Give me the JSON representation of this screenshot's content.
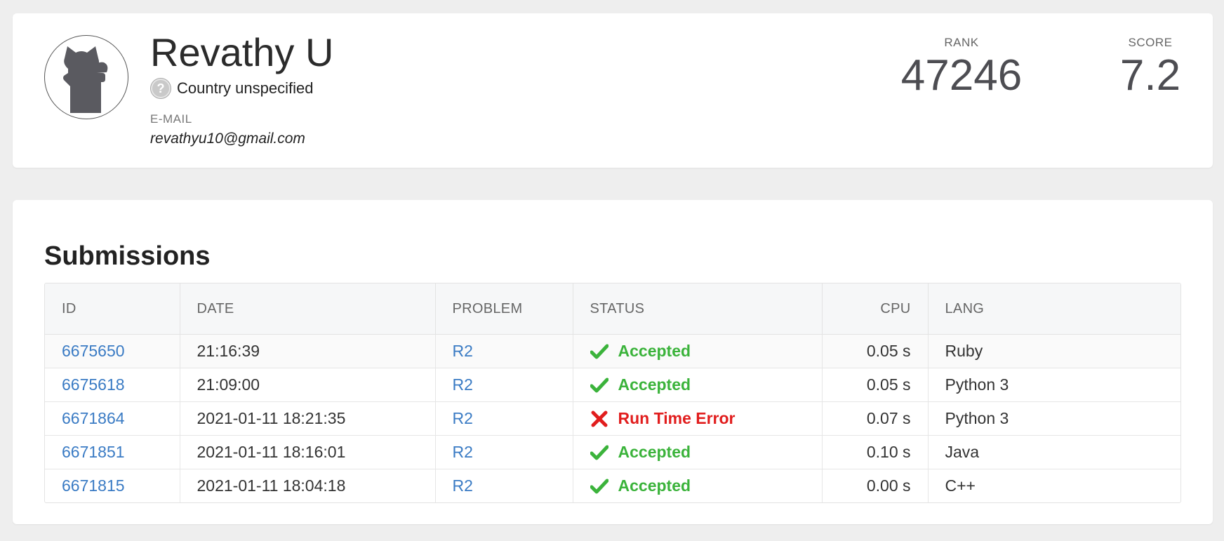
{
  "profile": {
    "name": "Revathy U",
    "country": "Country unspecified",
    "email_label": "E-MAIL",
    "email": "revathyu10@gmail.com",
    "rank_label": "RANK",
    "rank_value": "47246",
    "score_label": "SCORE",
    "score_value": "7.2"
  },
  "submissions": {
    "title": "Submissions",
    "columns": [
      "ID",
      "DATE",
      "PROBLEM",
      "STATUS",
      "CPU",
      "LANG"
    ],
    "rows": [
      {
        "id": "6675650",
        "date": "21:16:39",
        "problem": "R2",
        "status": "Accepted",
        "status_type": "accepted",
        "cpu": "0.05 s",
        "lang": "Ruby"
      },
      {
        "id": "6675618",
        "date": "21:09:00",
        "problem": "R2",
        "status": "Accepted",
        "status_type": "accepted",
        "cpu": "0.05 s",
        "lang": "Python 3"
      },
      {
        "id": "6671864",
        "date": "2021-01-11 18:21:35",
        "problem": "R2",
        "status": "Run Time Error",
        "status_type": "error",
        "cpu": "0.07 s",
        "lang": "Python 3"
      },
      {
        "id": "6671851",
        "date": "2021-01-11 18:16:01",
        "problem": "R2",
        "status": "Accepted",
        "status_type": "accepted",
        "cpu": "0.10 s",
        "lang": "Java"
      },
      {
        "id": "6671815",
        "date": "2021-01-11 18:04:18",
        "problem": "R2",
        "status": "Accepted",
        "status_type": "accepted",
        "cpu": "0.00 s",
        "lang": "C++"
      }
    ]
  },
  "colors": {
    "link": "#3a7bc4",
    "accepted": "#3bb33b",
    "error": "#e11d1d",
    "background": "#eeeeee"
  }
}
